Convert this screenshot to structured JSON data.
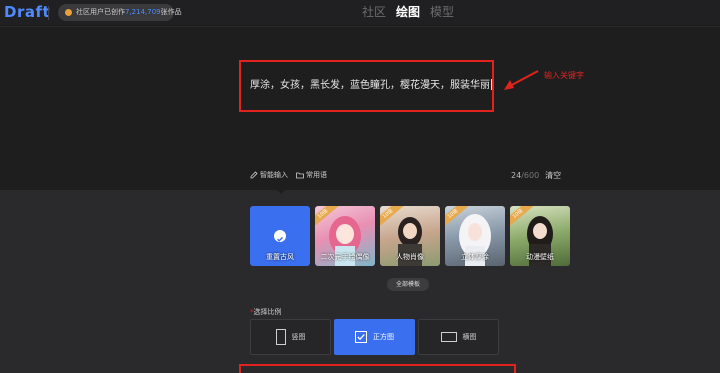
{
  "header": {
    "logo": "Draft",
    "stats_prefix": "社区用户已创作",
    "stats_number": "7,214,709",
    "stats_suffix": "张作品",
    "tabs": [
      {
        "label": "社区",
        "active": false
      },
      {
        "label": "绘图",
        "active": true
      },
      {
        "label": "模型",
        "active": false
      }
    ]
  },
  "prompt": {
    "value": "厚涂，女孩，黑长发，蓝色瞳孔，樱花漫天，服装华丽",
    "annotation": "输入关键字",
    "tools": [
      "智能输入",
      "常用语"
    ],
    "count": "24",
    "max": "/600",
    "clear": "清空"
  },
  "templates": {
    "items": [
      {
        "label": "重置古风",
        "badge": "",
        "selected": true
      },
      {
        "label": "二次元手绘偶像",
        "badge": "10倍",
        "selected": false
      },
      {
        "label": "人物肖像",
        "badge": "10倍",
        "selected": false
      },
      {
        "label": "立体厚涂",
        "badge": "10倍",
        "selected": false
      },
      {
        "label": "动漫壁纸",
        "badge": "10倍",
        "selected": false
      }
    ],
    "all_label": "全部模板"
  },
  "ratio": {
    "title": "选择比例",
    "options": [
      {
        "label": "竖图",
        "selected": false
      },
      {
        "label": "正方图",
        "selected": true
      },
      {
        "label": "横图",
        "selected": false
      }
    ]
  },
  "colors": {
    "accent": "#3a6ff0",
    "annotation": "#e0241d",
    "badge": "#e7a94e"
  }
}
